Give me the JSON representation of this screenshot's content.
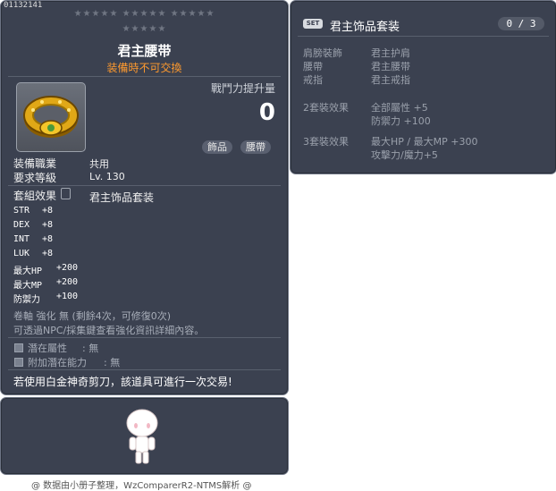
{
  "item": {
    "id": "01132141",
    "name": "君主腰带",
    "trade_note": "装備時不可交換",
    "stars_row1": "★★★★★ ★★★★★ ★★★★★",
    "stars_row2": "★★★★★",
    "icon": "gold-belt-icon",
    "combat_power_label": "戰鬥力提升量",
    "combat_power_value": "0",
    "tags": [
      "飾品",
      "腰帶"
    ],
    "job_label": "装備職業",
    "job_value": "共用",
    "level_label": "要求等級",
    "level_value": "Lv. 130",
    "set_label": "套組效果",
    "set_name": "君主饰品套装",
    "stats": [
      {
        "name": "STR",
        "value": "+8"
      },
      {
        "name": "DEX",
        "value": "+8"
      },
      {
        "name": "INT",
        "value": "+8"
      },
      {
        "name": "LUK",
        "value": "+8"
      },
      {
        "name": "最大HP",
        "value": "+200"
      },
      {
        "name": "最大MP",
        "value": "+200"
      },
      {
        "name": "防禦力",
        "value": "+100"
      }
    ],
    "enhance_line": "卷軸 強化 無 (剩餘4次，可修復0次)",
    "enhance_note": "可透過NPC/採集鍵查看強化資訊詳細內容。",
    "potential_label": "潛在屬性",
    "potential_value": ": 無",
    "bonus_potential_label": "附加潛在能力",
    "bonus_potential_value": ": 無",
    "platinum_note": "若使用白金神奇剪刀，該道具可進行一次交易!"
  },
  "set_panel": {
    "badge": "SET",
    "title": "君主饰品套装",
    "count": "0 / 3",
    "parts": [
      {
        "slot": "肩膀裝飾",
        "name": "君主护肩"
      },
      {
        "slot": "腰帶",
        "name": "君主腰带"
      },
      {
        "slot": "戒指",
        "name": "君主戒指"
      }
    ],
    "effects": [
      {
        "label": "2套裝效果",
        "lines": [
          "全部屬性 +5",
          "防禦力  +100"
        ]
      },
      {
        "label": "3套裝效果",
        "lines": [
          "最大HP / 最大MP  +300",
          "攻擊力/魔力+5"
        ]
      }
    ]
  },
  "footer": "@ 数据由小册子整理，WzComparerR2-NTMS解析 @",
  "colors": {
    "panel_bg": "#3b4150",
    "trade_note": "#ff9a2e",
    "muted_text": "#9aa0ab"
  }
}
